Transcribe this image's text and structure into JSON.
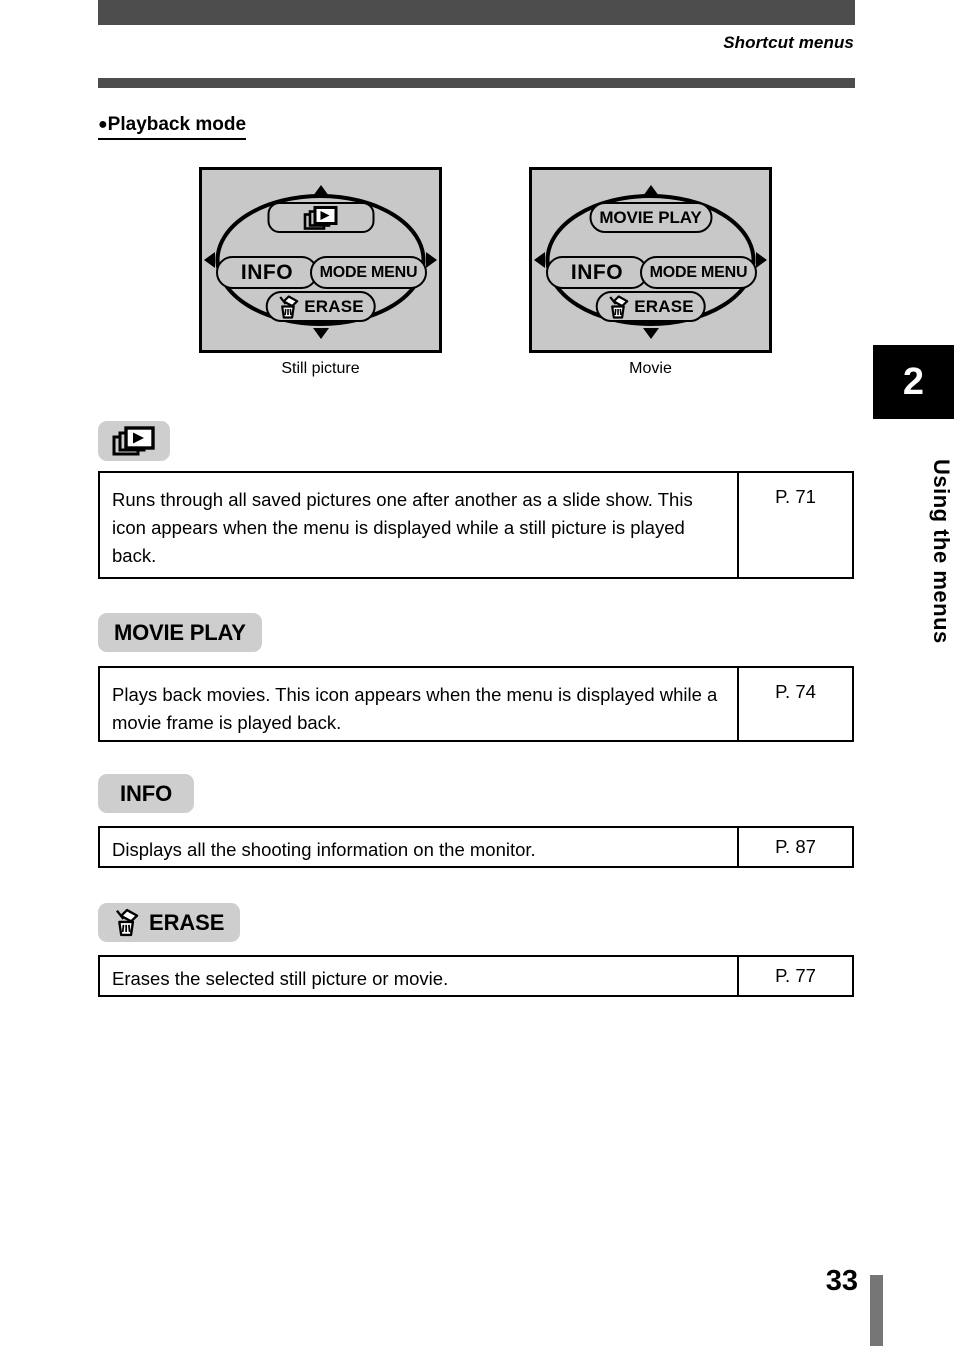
{
  "header": {
    "title": "Shortcut menus"
  },
  "section": {
    "bullet": "●",
    "heading": "Playback mode"
  },
  "diagrams": [
    {
      "id": "still",
      "caption": "Still picture",
      "top_label": "",
      "top_icon": "slideshow-icon",
      "left_label": "INFO",
      "right_label": "MODE MENU",
      "bottom_label": "ERASE",
      "bottom_icon": "erase-trash-icon",
      "arrows": [
        "up",
        "down",
        "left",
        "right"
      ]
    },
    {
      "id": "movie",
      "caption": "Movie",
      "top_label": "MOVIE PLAY",
      "top_icon": "",
      "left_label": "INFO",
      "right_label": "MODE MENU",
      "bottom_label": "ERASE",
      "bottom_icon": "erase-trash-icon",
      "arrows": [
        "up",
        "down",
        "left",
        "right"
      ]
    }
  ],
  "entries": [
    {
      "badge_label": "",
      "badge_icon": "slideshow-icon",
      "description": "Runs through all saved pictures one after another as a slide show. This icon appears when the menu is displayed while a still picture is played back.",
      "page_ref": "P. 71"
    },
    {
      "badge_label": "MOVIE PLAY",
      "badge_icon": "",
      "description": "Plays back movies. This icon appears when the menu is displayed while a movie frame is played back.",
      "page_ref": "P. 74"
    },
    {
      "badge_label": "INFO",
      "badge_icon": "",
      "description": "Displays all the shooting information on the monitor.",
      "page_ref": "P. 87"
    },
    {
      "badge_label": "ERASE",
      "badge_icon": "erase-trash-icon",
      "description": "Erases the selected still picture or movie.",
      "page_ref": "P. 77"
    }
  ],
  "chapter": {
    "number": "2",
    "label": "Using the menus"
  },
  "footer": {
    "page_number": "33"
  },
  "colors": {
    "rule": "#4d4d4d",
    "lcd_background": "#c8c8c8",
    "badge_background": "#cecece",
    "tab_background": "#000000",
    "footer_bar": "#767676"
  }
}
